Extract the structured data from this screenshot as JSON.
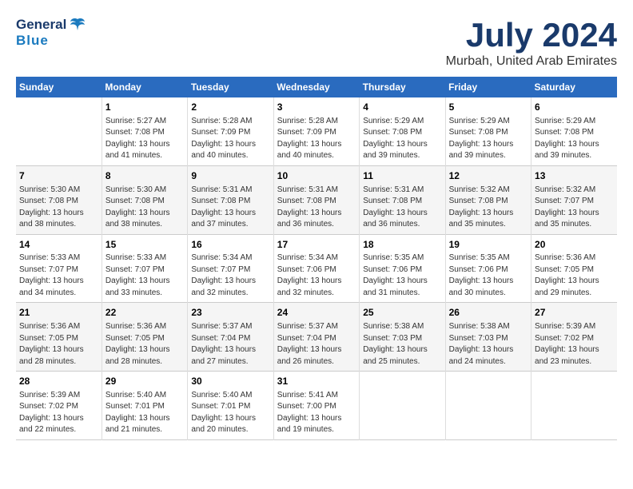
{
  "header": {
    "logo_general": "General",
    "logo_blue": "Blue",
    "month": "July 2024",
    "location": "Murbah, United Arab Emirates"
  },
  "days_of_week": [
    "Sunday",
    "Monday",
    "Tuesday",
    "Wednesday",
    "Thursday",
    "Friday",
    "Saturday"
  ],
  "weeks": [
    [
      {
        "day": "",
        "info": ""
      },
      {
        "day": "1",
        "info": "Sunrise: 5:27 AM\nSunset: 7:08 PM\nDaylight: 13 hours\nand 41 minutes."
      },
      {
        "day": "2",
        "info": "Sunrise: 5:28 AM\nSunset: 7:09 PM\nDaylight: 13 hours\nand 40 minutes."
      },
      {
        "day": "3",
        "info": "Sunrise: 5:28 AM\nSunset: 7:09 PM\nDaylight: 13 hours\nand 40 minutes."
      },
      {
        "day": "4",
        "info": "Sunrise: 5:29 AM\nSunset: 7:08 PM\nDaylight: 13 hours\nand 39 minutes."
      },
      {
        "day": "5",
        "info": "Sunrise: 5:29 AM\nSunset: 7:08 PM\nDaylight: 13 hours\nand 39 minutes."
      },
      {
        "day": "6",
        "info": "Sunrise: 5:29 AM\nSunset: 7:08 PM\nDaylight: 13 hours\nand 39 minutes."
      }
    ],
    [
      {
        "day": "7",
        "info": "Sunrise: 5:30 AM\nSunset: 7:08 PM\nDaylight: 13 hours\nand 38 minutes."
      },
      {
        "day": "8",
        "info": "Sunrise: 5:30 AM\nSunset: 7:08 PM\nDaylight: 13 hours\nand 38 minutes."
      },
      {
        "day": "9",
        "info": "Sunrise: 5:31 AM\nSunset: 7:08 PM\nDaylight: 13 hours\nand 37 minutes."
      },
      {
        "day": "10",
        "info": "Sunrise: 5:31 AM\nSunset: 7:08 PM\nDaylight: 13 hours\nand 36 minutes."
      },
      {
        "day": "11",
        "info": "Sunrise: 5:31 AM\nSunset: 7:08 PM\nDaylight: 13 hours\nand 36 minutes."
      },
      {
        "day": "12",
        "info": "Sunrise: 5:32 AM\nSunset: 7:08 PM\nDaylight: 13 hours\nand 35 minutes."
      },
      {
        "day": "13",
        "info": "Sunrise: 5:32 AM\nSunset: 7:07 PM\nDaylight: 13 hours\nand 35 minutes."
      }
    ],
    [
      {
        "day": "14",
        "info": "Sunrise: 5:33 AM\nSunset: 7:07 PM\nDaylight: 13 hours\nand 34 minutes."
      },
      {
        "day": "15",
        "info": "Sunrise: 5:33 AM\nSunset: 7:07 PM\nDaylight: 13 hours\nand 33 minutes."
      },
      {
        "day": "16",
        "info": "Sunrise: 5:34 AM\nSunset: 7:07 PM\nDaylight: 13 hours\nand 32 minutes."
      },
      {
        "day": "17",
        "info": "Sunrise: 5:34 AM\nSunset: 7:06 PM\nDaylight: 13 hours\nand 32 minutes."
      },
      {
        "day": "18",
        "info": "Sunrise: 5:35 AM\nSunset: 7:06 PM\nDaylight: 13 hours\nand 31 minutes."
      },
      {
        "day": "19",
        "info": "Sunrise: 5:35 AM\nSunset: 7:06 PM\nDaylight: 13 hours\nand 30 minutes."
      },
      {
        "day": "20",
        "info": "Sunrise: 5:36 AM\nSunset: 7:05 PM\nDaylight: 13 hours\nand 29 minutes."
      }
    ],
    [
      {
        "day": "21",
        "info": "Sunrise: 5:36 AM\nSunset: 7:05 PM\nDaylight: 13 hours\nand 28 minutes."
      },
      {
        "day": "22",
        "info": "Sunrise: 5:36 AM\nSunset: 7:05 PM\nDaylight: 13 hours\nand 28 minutes."
      },
      {
        "day": "23",
        "info": "Sunrise: 5:37 AM\nSunset: 7:04 PM\nDaylight: 13 hours\nand 27 minutes."
      },
      {
        "day": "24",
        "info": "Sunrise: 5:37 AM\nSunset: 7:04 PM\nDaylight: 13 hours\nand 26 minutes."
      },
      {
        "day": "25",
        "info": "Sunrise: 5:38 AM\nSunset: 7:03 PM\nDaylight: 13 hours\nand 25 minutes."
      },
      {
        "day": "26",
        "info": "Sunrise: 5:38 AM\nSunset: 7:03 PM\nDaylight: 13 hours\nand 24 minutes."
      },
      {
        "day": "27",
        "info": "Sunrise: 5:39 AM\nSunset: 7:02 PM\nDaylight: 13 hours\nand 23 minutes."
      }
    ],
    [
      {
        "day": "28",
        "info": "Sunrise: 5:39 AM\nSunset: 7:02 PM\nDaylight: 13 hours\nand 22 minutes."
      },
      {
        "day": "29",
        "info": "Sunrise: 5:40 AM\nSunset: 7:01 PM\nDaylight: 13 hours\nand 21 minutes."
      },
      {
        "day": "30",
        "info": "Sunrise: 5:40 AM\nSunset: 7:01 PM\nDaylight: 13 hours\nand 20 minutes."
      },
      {
        "day": "31",
        "info": "Sunrise: 5:41 AM\nSunset: 7:00 PM\nDaylight: 13 hours\nand 19 minutes."
      },
      {
        "day": "",
        "info": ""
      },
      {
        "day": "",
        "info": ""
      },
      {
        "day": "",
        "info": ""
      }
    ]
  ]
}
